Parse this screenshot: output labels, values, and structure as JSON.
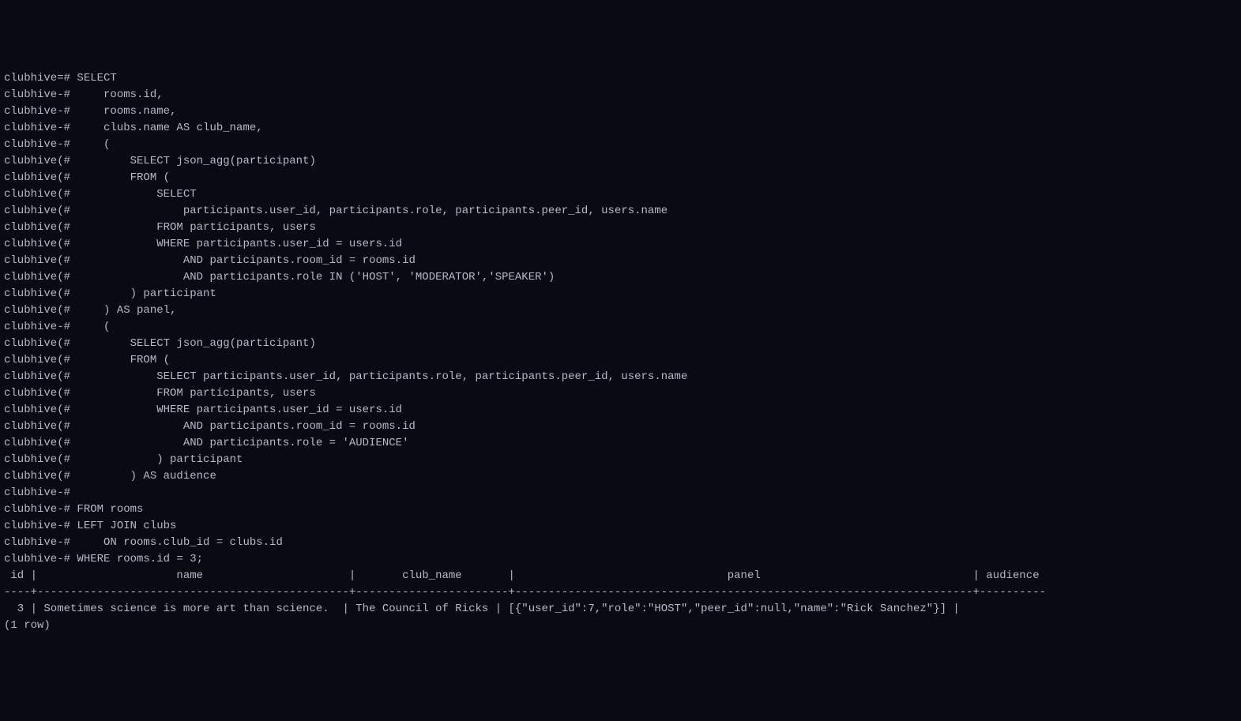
{
  "prompt_main": "clubhive=# ",
  "prompt_cont_dash": "clubhive-# ",
  "prompt_cont_paren": "clubhive(# ",
  "query_lines": [
    {
      "prompt": "main",
      "text": "SELECT"
    },
    {
      "prompt": "dash",
      "text": "    rooms.id,"
    },
    {
      "prompt": "dash",
      "text": "    rooms.name,"
    },
    {
      "prompt": "dash",
      "text": "    clubs.name AS club_name,"
    },
    {
      "prompt": "dash",
      "text": "    ("
    },
    {
      "prompt": "paren",
      "text": "        SELECT json_agg(participant)"
    },
    {
      "prompt": "paren",
      "text": "        FROM ("
    },
    {
      "prompt": "paren",
      "text": "            SELECT"
    },
    {
      "prompt": "paren",
      "text": "                participants.user_id, participants.role, participants.peer_id, users.name"
    },
    {
      "prompt": "paren",
      "text": "            FROM participants, users"
    },
    {
      "prompt": "paren",
      "text": "            WHERE participants.user_id = users.id"
    },
    {
      "prompt": "paren",
      "text": "                AND participants.room_id = rooms.id"
    },
    {
      "prompt": "paren",
      "text": "                AND participants.role IN ('HOST', 'MODERATOR','SPEAKER')"
    },
    {
      "prompt": "paren",
      "text": "        ) participant"
    },
    {
      "prompt": "paren",
      "text": "    ) AS panel,"
    },
    {
      "prompt": "dash",
      "text": "    ("
    },
    {
      "prompt": "paren",
      "text": "        SELECT json_agg(participant)"
    },
    {
      "prompt": "paren",
      "text": "        FROM ("
    },
    {
      "prompt": "paren",
      "text": "            SELECT participants.user_id, participants.role, participants.peer_id, users.name"
    },
    {
      "prompt": "paren",
      "text": "            FROM participants, users"
    },
    {
      "prompt": "paren",
      "text": "            WHERE participants.user_id = users.id"
    },
    {
      "prompt": "paren",
      "text": "                AND participants.room_id = rooms.id"
    },
    {
      "prompt": "paren",
      "text": "                AND participants.role = 'AUDIENCE'"
    },
    {
      "prompt": "paren",
      "text": "            ) participant"
    },
    {
      "prompt": "paren",
      "text": "        ) AS audience"
    },
    {
      "prompt": "dash",
      "text": ""
    },
    {
      "prompt": "dash",
      "text": "FROM rooms"
    },
    {
      "prompt": "dash",
      "text": "LEFT JOIN clubs"
    },
    {
      "prompt": "dash",
      "text": "    ON rooms.club_id = clubs.id"
    },
    {
      "prompt": "dash",
      "text": "WHERE rooms.id = 3;"
    }
  ],
  "result_header": " id |                     name                      |       club_name       |                                panel                                | audience ",
  "result_separator": "----+-----------------------------------------------+-----------------------+---------------------------------------------------------------------+----------",
  "result_row": "  3 | Sometimes science is more art than science.  | The Council of Ricks | [{\"user_id\":7,\"role\":\"HOST\",\"peer_id\":null,\"name\":\"Rick Sanchez\"}] | ",
  "result_count": "(1 row)"
}
